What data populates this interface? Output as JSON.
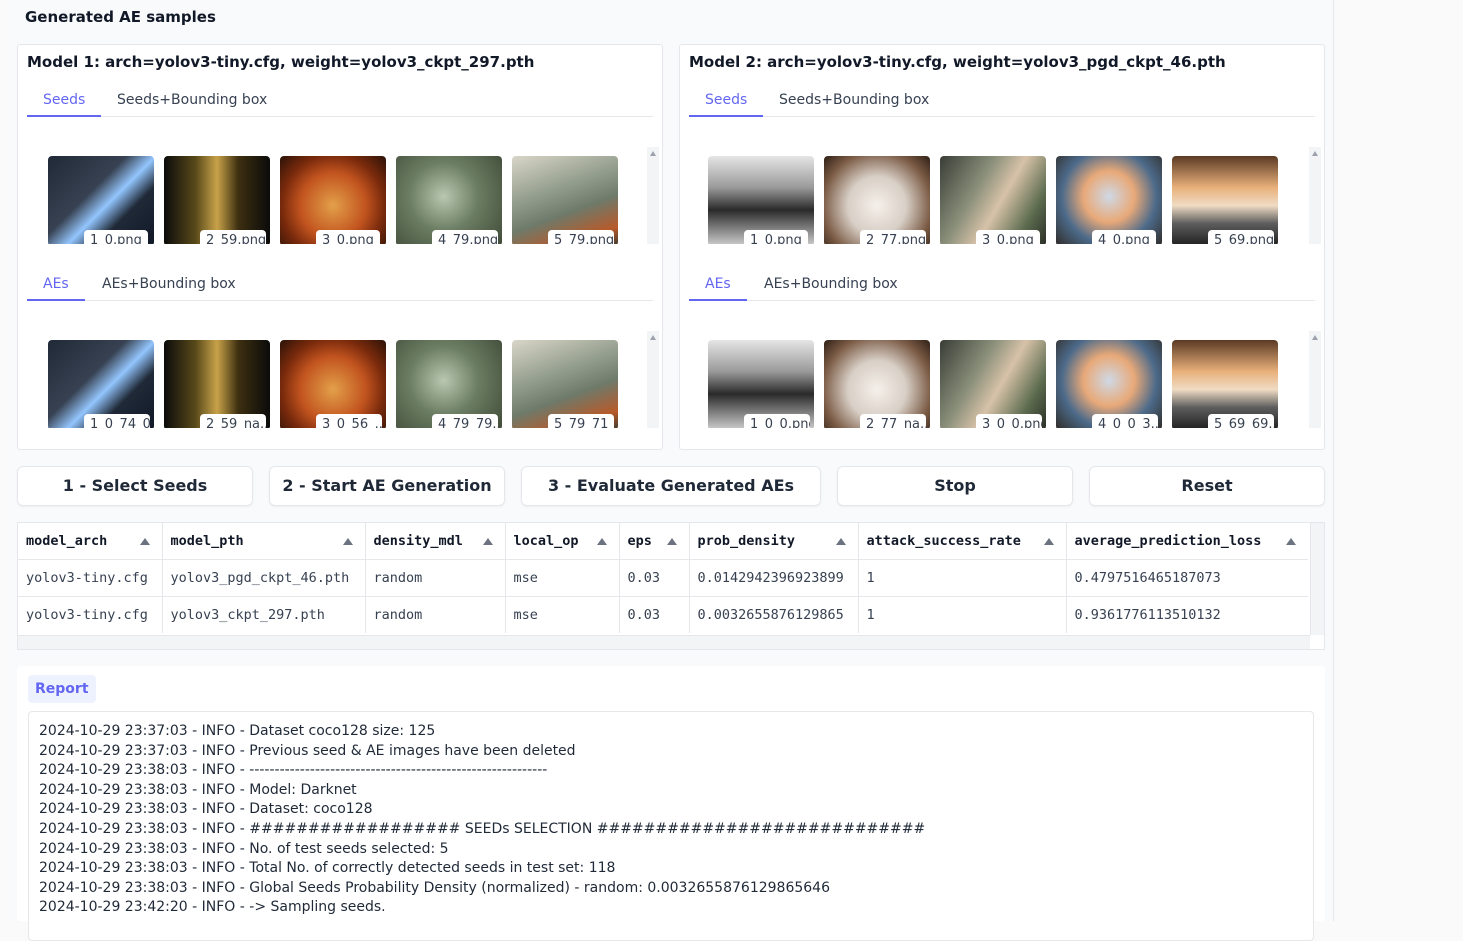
{
  "section_title": "Generated AE samples",
  "models": [
    {
      "title": "Model 1: arch=yolov3-tiny.cfg, weight=yolov3_ckpt_297.pth",
      "seed_tabs": [
        "Seeds",
        "Seeds+Bounding box"
      ],
      "ae_tabs": [
        "AEs",
        "AEs+Bounding box"
      ],
      "seeds": [
        "1_0.png",
        "2_59.png",
        "3_0.png",
        "4_79.png",
        "5_79.png"
      ],
      "aes": [
        "1_0_74_0...",
        "2_59_na....",
        "3_0_56_...",
        "4_79_79....",
        "5_79_71_..."
      ]
    },
    {
      "title": "Model 2: arch=yolov3-tiny.cfg, weight=yolov3_pgd_ckpt_46.pth",
      "seed_tabs": [
        "Seeds",
        "Seeds+Bounding box"
      ],
      "ae_tabs": [
        "AEs",
        "AEs+Bounding box"
      ],
      "seeds": [
        "1_0.png",
        "2_77.png",
        "3_0.png",
        "4_0.png",
        "5_69.png"
      ],
      "aes": [
        "1_0_0.png",
        "2_77_na....",
        "3_0_0.png",
        "4_0_0_3....",
        "5_69_69...."
      ]
    }
  ],
  "buttons": {
    "select_seeds": "1 - Select Seeds",
    "start_ae": "2 - Start AE Generation",
    "evaluate": "3 - Evaluate Generated AEs",
    "stop": "Stop",
    "reset": "Reset"
  },
  "table": {
    "headers": [
      "model_arch",
      "model_pth",
      "density_mdl",
      "local_op",
      "eps",
      "prob_density",
      "attack_success_rate",
      "average_prediction_loss"
    ],
    "rows": [
      [
        "yolov3-tiny.cfg",
        "yolov3_pgd_ckpt_46.pth",
        "random",
        "mse",
        "0.03",
        "0.0142942396923899",
        "1",
        "0.4797516465187073"
      ],
      [
        "yolov3-tiny.cfg",
        "yolov3_ckpt_297.pth",
        "random",
        "mse",
        "0.03",
        "0.0032655876129865",
        "1",
        "0.9361776113510132"
      ]
    ]
  },
  "report": {
    "label": "Report",
    "lines": [
      "2024-10-29 23:37:03 - INFO - Dataset coco128 size: 125",
      "2024-10-29 23:37:03 - INFO - Previous seed & AE images have been deleted",
      "2024-10-29 23:38:03 - INFO - -----------------------------------------------------------",
      "2024-10-29 23:38:03 - INFO - Model: Darknet",
      "2024-10-29 23:38:03 - INFO - Dataset: coco128",
      "2024-10-29 23:38:03 - INFO - ################## SEEDs SELECTION ############################",
      "2024-10-29 23:38:03 - INFO - No. of test seeds selected: 5",
      "2024-10-29 23:38:03 - INFO - Total No. of correctly detected seeds in test set: 118",
      "2024-10-29 23:38:03 - INFO - Global Seeds Probability Density (normalized) - random: 0.0032655876129865646",
      "2024-10-29 23:42:20 - INFO - -> Sampling seeds."
    ]
  },
  "colors": {
    "accent": "#6366f1"
  }
}
